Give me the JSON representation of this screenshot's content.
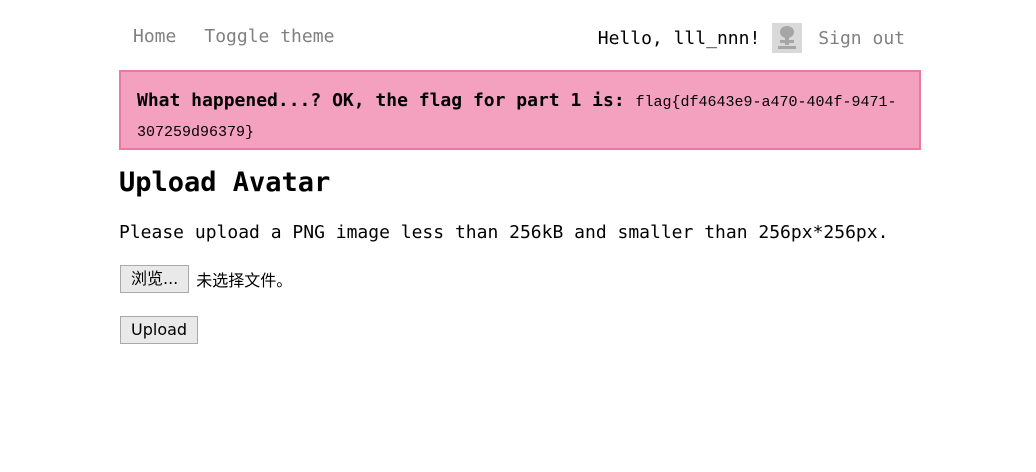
{
  "nav": {
    "home": "Home",
    "toggle_theme": "Toggle theme",
    "greeting": "Hello, lll_nnn!",
    "sign_out": "Sign out"
  },
  "flash": {
    "message": "What happened...? OK, the flag for part 1 is: ",
    "flag": "flag{df4643e9-a470-404f-9471-307259d96379}",
    "background": "#f4a0bf",
    "border": "#e87aa0"
  },
  "main": {
    "heading": "Upload Avatar",
    "description": "Please upload a PNG image less than 256kB and smaller than 256px*256px.",
    "file_input": {
      "browse_label": "浏览...",
      "status": "未选择文件。"
    },
    "upload_label": "Upload"
  }
}
